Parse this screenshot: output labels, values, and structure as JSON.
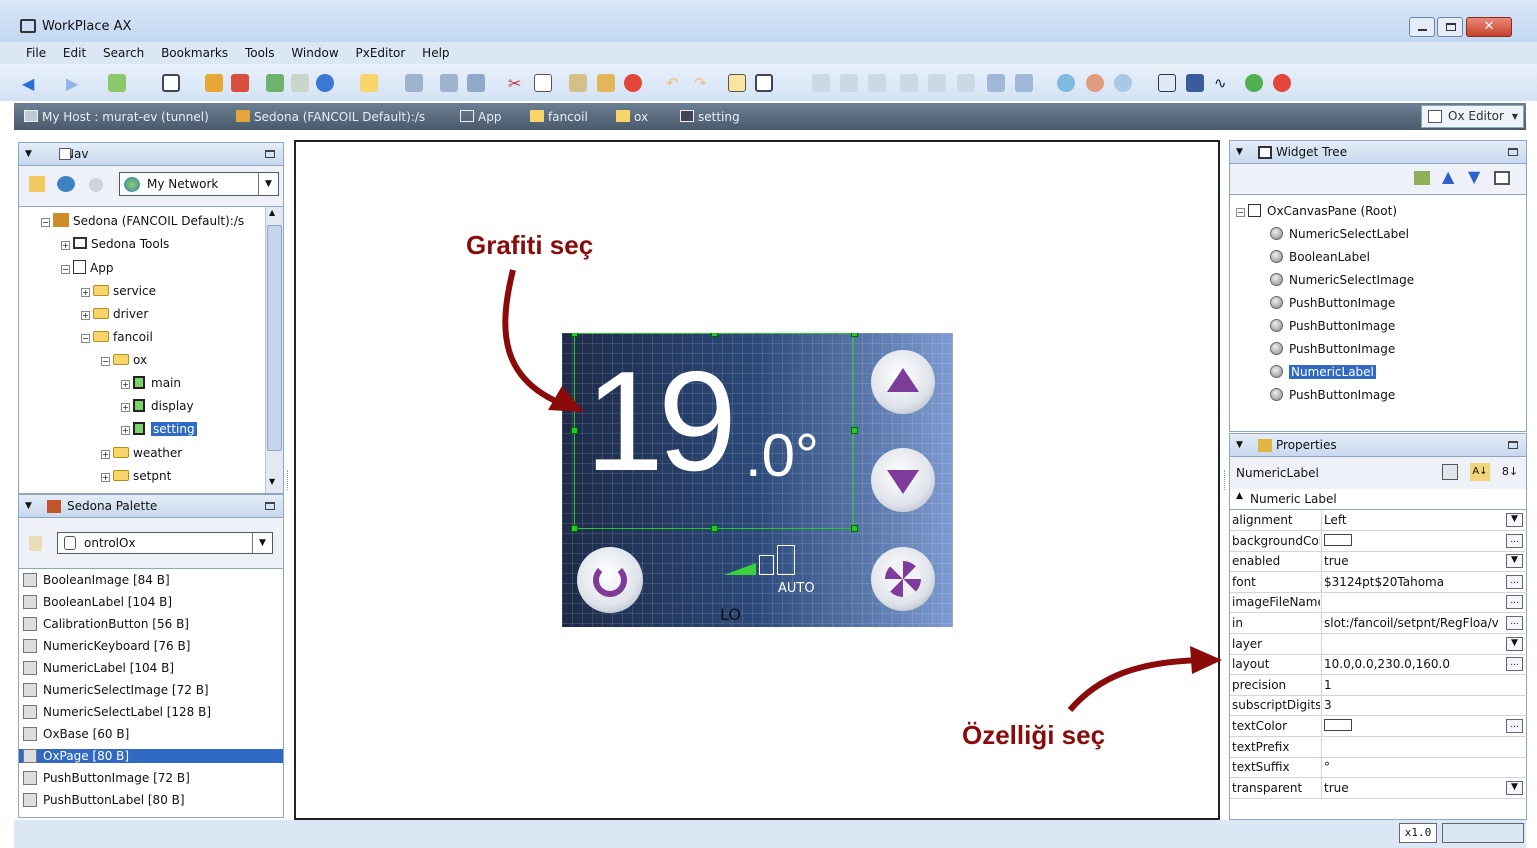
{
  "window": {
    "title": "WorkPlace AX"
  },
  "menu": [
    "File",
    "Edit",
    "Search",
    "Bookmarks",
    "Tools",
    "Window",
    "PxEditor",
    "Help"
  ],
  "locbar": {
    "crumbs": [
      "My Host : murat-ev (tunnel)",
      "Sedona (FANCOIL Default):/s",
      "App",
      "fancoil",
      "ox",
      "setting"
    ],
    "ox_editor": "Ox Editor"
  },
  "nav": {
    "title": "Nav",
    "network": "My Network",
    "tree": [
      {
        "label": "Sedona (FANCOIL Default):/s",
        "icon": "sedona-icon"
      },
      {
        "label": "Sedona Tools",
        "icon": "tools-icon"
      },
      {
        "label": "App",
        "icon": "app-icon"
      },
      {
        "label": "service",
        "icon": "folder-icon"
      },
      {
        "label": "driver",
        "icon": "folder-icon"
      },
      {
        "label": "fancoil",
        "icon": "folder-icon"
      },
      {
        "label": "ox",
        "icon": "folder-icon"
      },
      {
        "label": "main",
        "icon": "page-icon"
      },
      {
        "label": "display",
        "icon": "page-icon"
      },
      {
        "label": "setting",
        "icon": "page-icon",
        "selected": true
      },
      {
        "label": "weather",
        "icon": "folder-icon"
      },
      {
        "label": "setpnt",
        "icon": "folder-icon"
      }
    ]
  },
  "palette": {
    "title": "Sedona Palette",
    "combo": "ontrolOx",
    "items": [
      "BooleanImage [84 B]",
      "BooleanLabel [104 B]",
      "CalibrationButton [56 B]",
      "NumericKeyboard [76 B]",
      "NumericLabel [104 B]",
      "NumericSelectImage [72 B]",
      "NumericSelectLabel [128 B]",
      "OxBase [60 B]",
      "OxPage [80 B]",
      "PushButtonImage [72 B]",
      "PushButtonLabel [80 B]"
    ],
    "selected_index": 8
  },
  "thermostat": {
    "temp_main": "19",
    "temp_decimal": ".0°",
    "mode": "AUTO",
    "speed": "LO"
  },
  "annotations": {
    "select_graphic": "Grafiti seç",
    "select_property": "Özelliği seç"
  },
  "widget_tree": {
    "title": "Widget Tree",
    "root": "OxCanvasPane (Root)",
    "children": [
      "NumericSelectLabel",
      "BooleanLabel",
      "NumericSelectImage",
      "PushButtonImage",
      "PushButtonImage",
      "PushButtonImage",
      "NumericLabel",
      "PushButtonImage"
    ],
    "selected_index": 6
  },
  "properties": {
    "title": "Properties",
    "object": "NumericLabel",
    "group": "Numeric Label",
    "rows": [
      {
        "name": "alignment",
        "value": "Left",
        "ctl": "dropdown"
      },
      {
        "name": "backgroundColor",
        "value": "",
        "ctl": "more",
        "swatch": true
      },
      {
        "name": "enabled",
        "value": "true",
        "ctl": "dropdown"
      },
      {
        "name": "font",
        "value": "$3124pt$20Tahoma",
        "ctl": "more"
      },
      {
        "name": "imageFileName",
        "value": "",
        "ctl": "more"
      },
      {
        "name": "in",
        "value": "slot:/fancoil/setpnt/RegFloa/v",
        "ctl": "more"
      },
      {
        "name": "layer",
        "value": "",
        "ctl": "dropdown"
      },
      {
        "name": "layout",
        "value": "10.0,0.0,230.0,160.0",
        "ctl": "more"
      },
      {
        "name": "precision",
        "value": "1",
        "ctl": ""
      },
      {
        "name": "subscriptDigits",
        "value": "3",
        "ctl": ""
      },
      {
        "name": "textColor",
        "value": "",
        "ctl": "more",
        "swatch": true
      },
      {
        "name": "textPrefix",
        "value": "",
        "ctl": ""
      },
      {
        "name": "textSuffix",
        "value": "°",
        "ctl": ""
      },
      {
        "name": "transparent",
        "value": "true",
        "ctl": "dropdown"
      }
    ]
  },
  "status": {
    "zoom": "x1.0"
  },
  "colors": {
    "accent": "#316ac5",
    "annotation": "#8b0a0a",
    "handle": "#22cc22"
  }
}
